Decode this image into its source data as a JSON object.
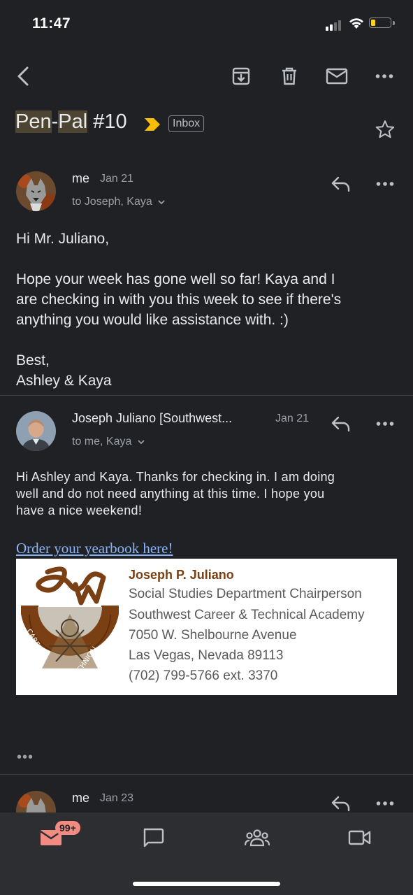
{
  "status_bar": {
    "time": "11:47"
  },
  "toolbar": {
    "icons": [
      "back-arrow-icon",
      "archive-icon",
      "trash-icon",
      "mail-icon",
      "more-icon"
    ]
  },
  "thread": {
    "subject_parts": [
      "Pen",
      "-",
      "Pal",
      " #10"
    ],
    "label": "Inbox"
  },
  "messages": [
    {
      "sender": "me",
      "date": "Jan 21",
      "to": "to Joseph, Kaya",
      "body": [
        "Hi Mr. Juliano,",
        "Hope your week has gone well so far! Kaya and I",
        "are checking in with you this week to see if there's",
        "anything you would like assistance with. :)",
        "Best,",
        "Ashley & Kaya"
      ]
    },
    {
      "sender": "Joseph Juliano [Southwest...",
      "date": "Jan 21",
      "to": "to me, Kaya",
      "body": [
        "Hi Ashley and Kaya. Thanks for checking in. I am doing",
        "well and do not need anything at this time. I hope you",
        "have a nice weekend!"
      ],
      "link": "Order your yearbook here!",
      "signature": {
        "name": "Joseph P. Juliano",
        "lines": [
          "Social Studies Department Chairperson",
          "Southwest Career & Technical Academy",
          "7050 W. Shelbourne Avenue",
          "Las Vegas, Nevada 89113",
          "(702) 799-5766 ext. 3370"
        ],
        "logo_text": "CAREER AND TECHNICAL ACADEMY"
      },
      "collapsed_indicator": "•••"
    },
    {
      "sender": "me",
      "date": "Jan 23"
    }
  ],
  "bottom_nav": {
    "mail_badge": "99+",
    "items": [
      "mail-icon",
      "chat-icon",
      "spaces-icon",
      "meet-icon"
    ]
  },
  "colors": {
    "background": "#202124",
    "accent_badge": "#f28b82",
    "label_arrow": "#fbbc04",
    "link": "#8ab4f8"
  }
}
